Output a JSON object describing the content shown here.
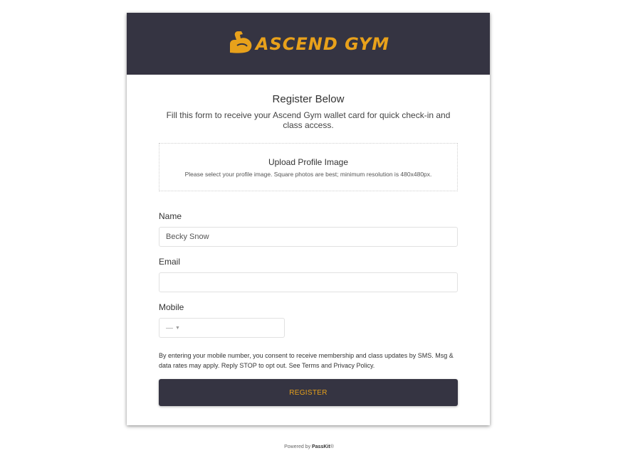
{
  "brand": {
    "logo_text": "ASCEND GYM",
    "accent_color": "#e8a11b",
    "header_color": "#353442",
    "logo_icon": "flexed-arm-icon"
  },
  "form": {
    "title": "Register Below",
    "subtitle": "Fill this form to receive your Ascend Gym wallet card for quick check-in and class access.",
    "upload": {
      "title": "Upload Profile Image",
      "hint": "Please select your profile image. Square photos are best; minimum resolution is 480x480px."
    },
    "name": {
      "label": "Name",
      "value": "Becky Snow"
    },
    "email": {
      "label": "Email",
      "value": ""
    },
    "mobile": {
      "label": "Mobile",
      "country_placeholder": "---",
      "value": ""
    },
    "consent": "By entering your mobile number, you consent to receive membership and class updates by SMS. Msg & data rates may apply. Reply STOP to opt out. See Terms and Privacy Policy.",
    "submit_label": "REGISTER"
  },
  "footer": {
    "powered_by": "Powered by",
    "brand": "PassKit",
    "mark": "®"
  }
}
